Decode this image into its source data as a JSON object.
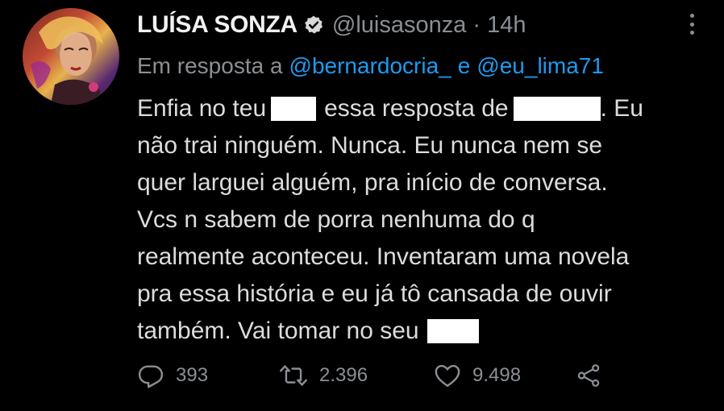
{
  "author": {
    "display_name": "LUÍSA SONZA",
    "handle": "@luisasonza",
    "separator": "·",
    "time": "14h"
  },
  "reply": {
    "prefix": "Em resposta a",
    "mention_1": "@bernardocria_",
    "conjunction": "e",
    "mention_2": "@eu_lima71"
  },
  "body": {
    "line1_a": "Enfia no teu",
    "line1_b": "essa resposta de",
    "line1_c": ". Eu",
    "line2": "não trai ninguém. Nunca. Eu nunca nem se",
    "line3": "quer larguei alguém, pra início de conversa.",
    "line4": "Vcs n sabem de porra nenhuma do q",
    "line5": "realmente aconteceu. Inventaram uma novela",
    "line6": "pra essa história e eu já tô cansada de ouvir",
    "line7": "também. Vai tomar no seu"
  },
  "stats": {
    "replies": "393",
    "retweets": "2.396",
    "likes": "9.498"
  },
  "colors": {
    "background": "#000000",
    "text": "#dcdcdc",
    "muted": "#8b8f94",
    "mention": "#1d9bf0",
    "redaction": "#ffffff"
  },
  "icons": {
    "verified": "verified-badge-icon",
    "more": "more-options-icon",
    "reply": "reply-icon",
    "retweet": "retweet-icon",
    "like": "heart-icon",
    "share": "share-icon"
  }
}
